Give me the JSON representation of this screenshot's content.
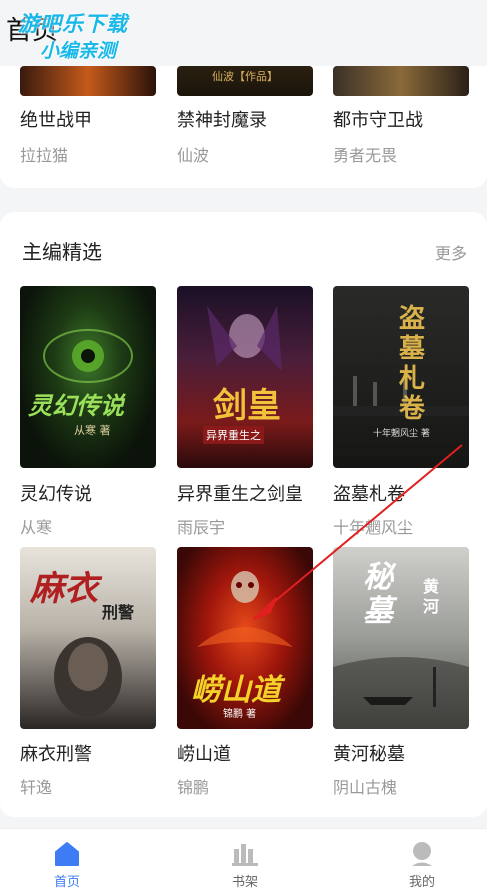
{
  "header": {
    "title": "首页",
    "watermark_line1": "游吧乐下载",
    "watermark_line2": "小编亲测"
  },
  "top_row": [
    {
      "title": "绝世战甲",
      "author": "拉拉猫",
      "cover_text": ""
    },
    {
      "title": "禁神封魔录",
      "author": "仙波",
      "cover_text": "仙波【作品】"
    },
    {
      "title": "都市守卫战",
      "author": "勇者无畏",
      "cover_text": ""
    }
  ],
  "section": {
    "title": "主编精选",
    "more": "更多"
  },
  "books": [
    {
      "title": "灵幻传说",
      "author": "从寒",
      "cover_text": "灵幻传说",
      "cover_sub": "从寒 著"
    },
    {
      "title": "异界重生之剑皇",
      "author": "雨辰宇",
      "cover_text": "剑皇",
      "cover_sub": "异界重生之"
    },
    {
      "title": "盗墓札卷",
      "author": "十年魍风尘",
      "cover_text": "盗墓札卷",
      "cover_sub": "十年魍风尘 著"
    },
    {
      "title": "麻衣刑警",
      "author": "轩逸",
      "cover_text": "麻衣",
      "cover_sub": "刑警"
    },
    {
      "title": "崂山道",
      "author": "锦鹏",
      "cover_text": "崂山道",
      "cover_sub": "锦鹏 著"
    },
    {
      "title": "黄河秘墓",
      "author": "阴山古槐",
      "cover_text": "秘墓",
      "cover_sub": "黄河"
    }
  ],
  "tabbar": [
    {
      "label": "首页",
      "icon": "home-icon",
      "active": true
    },
    {
      "label": "书架",
      "icon": "bookshelf-icon",
      "active": false
    },
    {
      "label": "我的",
      "icon": "profile-icon",
      "active": false
    }
  ],
  "colors": {
    "accent": "#3d7cf5",
    "watermark": "#19b8e8",
    "annotation_arrow": "#e02020"
  }
}
